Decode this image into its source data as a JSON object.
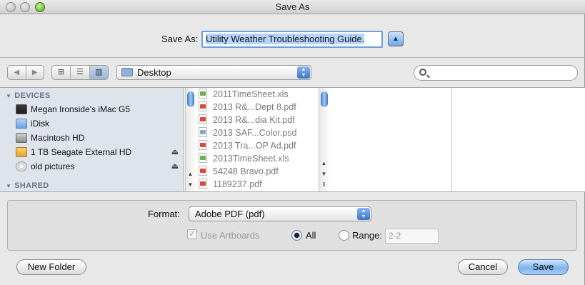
{
  "window": {
    "title": "Save As"
  },
  "save_as": {
    "label": "Save As:",
    "filename": "Utility Weather Troubleshooting Guide."
  },
  "toolbar": {
    "back_icon": "◀",
    "forward_icon": "▶",
    "location": "Desktop",
    "search_value": ""
  },
  "sidebar": {
    "devices_header": "DEVICES",
    "shared_header": "SHARED",
    "items": [
      {
        "label": "Megan   Ironside's iMac G5",
        "icon": "computer-icon",
        "eject": false
      },
      {
        "label": "iDisk",
        "icon": "idisk-icon",
        "eject": false
      },
      {
        "label": "Macintosh HD",
        "icon": "hard-drive-icon",
        "eject": false
      },
      {
        "label": "1 TB Seagate External HD",
        "icon": "external-drive-icon",
        "eject": true
      },
      {
        "label": "old pictures",
        "icon": "disc-icon",
        "eject": true
      }
    ]
  },
  "files": [
    {
      "name": "2011TimeSheet.xls",
      "type": "xls"
    },
    {
      "name": "2013 R&...Dept 8.pdf",
      "type": "pdf"
    },
    {
      "name": "2013 R&...dia Kit.pdf",
      "type": "pdf"
    },
    {
      "name": "2013 SAF...Color.psd",
      "type": "psd"
    },
    {
      "name": "2013 Tra...OP Ad.pdf",
      "type": "pdf"
    },
    {
      "name": "2013TimeSheet.xls",
      "type": "xls"
    },
    {
      "name": "54248 Bravo.pdf",
      "type": "pdf"
    },
    {
      "name": "1189237.pdf",
      "type": "pdf"
    }
  ],
  "options": {
    "format_label": "Format:",
    "format_value": "Adobe PDF (pdf)",
    "use_artboards_label": "Use Artboards",
    "all_label": "All",
    "range_label": "Range:",
    "range_value": "2-2"
  },
  "buttons": {
    "new_folder": "New Folder",
    "cancel": "Cancel",
    "save": "Save"
  },
  "colors": {
    "accent": "#6fa6e8",
    "sidebar_bg": "#dee4ec"
  }
}
